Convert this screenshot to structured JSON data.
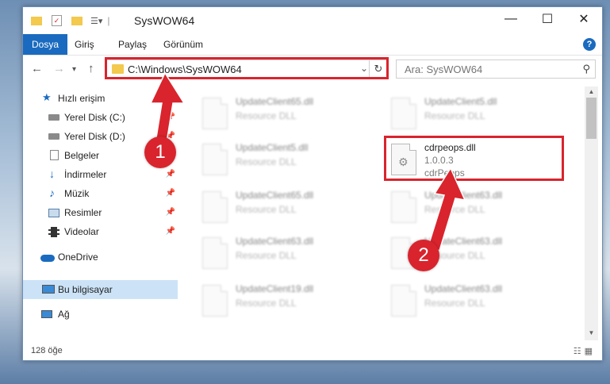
{
  "window": {
    "title": "SysWOW64"
  },
  "ribbon": {
    "tabs": [
      "Dosya",
      "Giriş",
      "Paylaş",
      "Görünüm"
    ],
    "help": "?"
  },
  "nav": {
    "path": "C:\\Windows\\SysWOW64",
    "search_placeholder": "Ara: SysWOW64"
  },
  "sidebar": {
    "items": [
      {
        "label": "Hızlı erişim",
        "icon": "star-icon"
      },
      {
        "label": "Yerel Disk (C:)",
        "icon": "drive-icon",
        "pinned": true
      },
      {
        "label": "Yerel Disk (D:)",
        "icon": "drive-icon",
        "pinned": true
      },
      {
        "label": "Belgeler",
        "icon": "document-icon",
        "pinned": true
      },
      {
        "label": "İndirmeler",
        "icon": "download-icon",
        "pinned": true
      },
      {
        "label": "Müzik",
        "icon": "music-icon",
        "pinned": true
      },
      {
        "label": "Resimler",
        "icon": "picture-icon",
        "pinned": true
      },
      {
        "label": "Videolar",
        "icon": "video-icon",
        "pinned": true
      },
      {
        "label": "OneDrive",
        "icon": "cloud-icon"
      },
      {
        "label": "Bu bilgisayar",
        "icon": "computer-icon"
      },
      {
        "label": "Ağ",
        "icon": "network-icon"
      }
    ]
  },
  "files": [
    {
      "name": "UpdateClient65.dll",
      "desc": "Resource DLL"
    },
    {
      "name": "UpdateClient5.dll",
      "desc": "Resource DLL"
    },
    {
      "name": "UpdateClient5.dll",
      "desc": "Resource DLL"
    },
    {
      "name": "cdrpeops.dll",
      "version": "1.0.0.3",
      "company": "cdrPeops"
    },
    {
      "name": "UpdateClient65.dll",
      "desc": "Resource DLL"
    },
    {
      "name": "UpdateClient63.dll",
      "desc": "Resource DLL"
    },
    {
      "name": "UpdateClient63.dll",
      "desc": "Resource DLL"
    },
    {
      "name": "UpdateClient63.dll",
      "desc": "Resource DLL"
    },
    {
      "name": "UpdateClient19.dll",
      "desc": "Resource DLL"
    },
    {
      "name": "UpdateClient63.dll",
      "desc": "Resource DLL"
    }
  ],
  "status": {
    "count": "128 öğe"
  },
  "annotations": {
    "badge1": "1",
    "badge2": "2"
  },
  "colors": {
    "accent": "#1a6bbf",
    "highlight": "#d9242d",
    "selected": "#cce3f7"
  }
}
